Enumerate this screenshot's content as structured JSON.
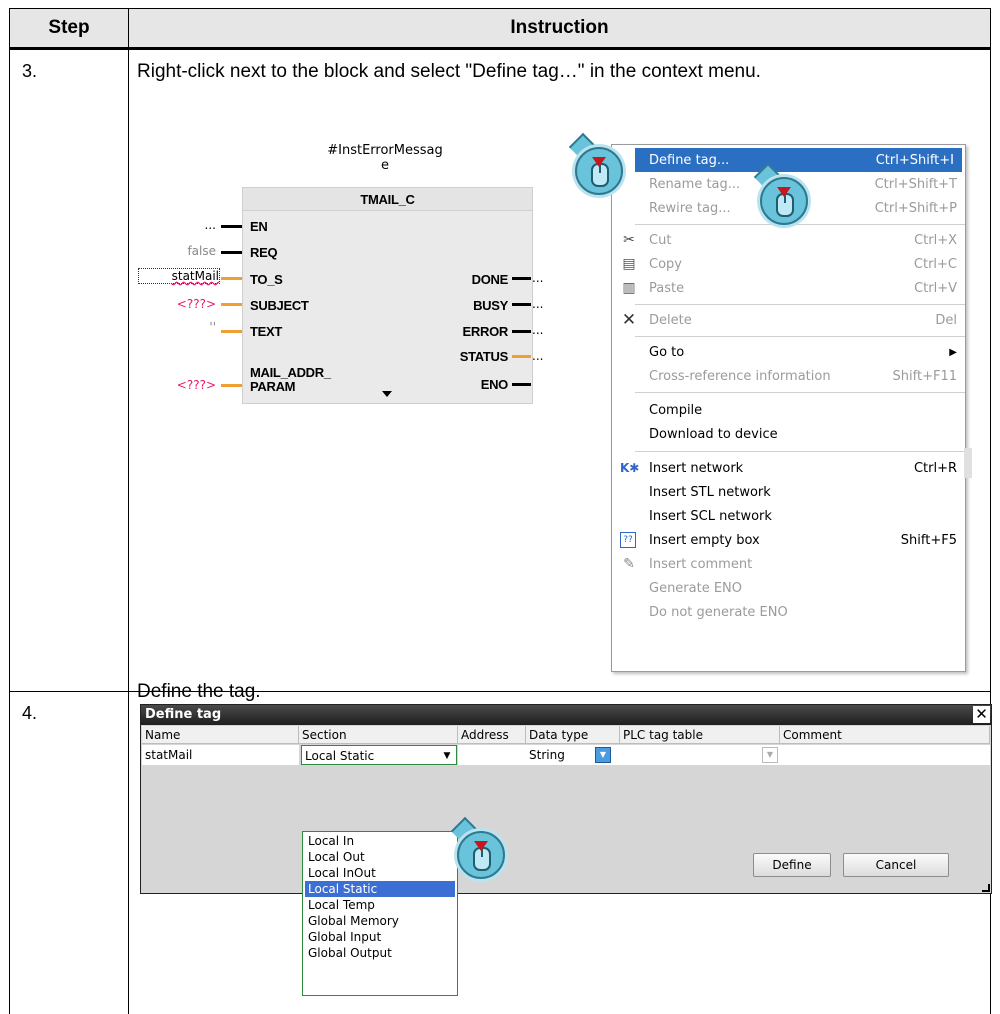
{
  "table": {
    "col_step": "Step",
    "col_instruction": "Instruction",
    "rows": [
      {
        "step": "3.",
        "instruction": "Right-click next to the block and select \"Define tag…\" in the context menu."
      },
      {
        "step": "4.",
        "instruction": "Define the tag."
      }
    ]
  },
  "fbd": {
    "instance_line1": "#InstErrorMessag",
    "instance_line2": "e",
    "block_name": "TMAIL_C",
    "inputs": [
      {
        "pin": "EN",
        "value": "..."
      },
      {
        "pin": "REQ",
        "value": "false"
      },
      {
        "pin": "TO_S",
        "value": "statMail"
      },
      {
        "pin": "SUBJECT",
        "value": "<???>"
      },
      {
        "pin": "TEXT",
        "value": "''"
      },
      {
        "pin": "MAIL_ADDR_",
        "value": ""
      },
      {
        "pin": "PARAM",
        "value": "<???>"
      }
    ],
    "outputs": [
      {
        "pin": "DONE",
        "value": "..."
      },
      {
        "pin": "BUSY",
        "value": "..."
      },
      {
        "pin": "ERROR",
        "value": "..."
      },
      {
        "pin": "STATUS",
        "value": "..."
      },
      {
        "pin": "ENO",
        "value": ""
      }
    ]
  },
  "context_menu": {
    "items": [
      {
        "label": "Define tag...",
        "shortcut": "Ctrl+Shift+I",
        "state": "selected",
        "icon": ""
      },
      {
        "label": "Rename tag...",
        "shortcut": "Ctrl+Shift+T",
        "state": "disabled",
        "icon": ""
      },
      {
        "label": "Rewire tag...",
        "shortcut": "Ctrl+Shift+P",
        "state": "disabled",
        "icon": ""
      },
      {
        "label": "Cut",
        "shortcut": "Ctrl+X",
        "state": "disabled",
        "icon": "scissors-icon"
      },
      {
        "label": "Copy",
        "shortcut": "Ctrl+C",
        "state": "disabled",
        "icon": "copy-icon"
      },
      {
        "label": "Paste",
        "shortcut": "Ctrl+V",
        "state": "disabled",
        "icon": "paste-icon"
      },
      {
        "label": "Delete",
        "shortcut": "Del",
        "state": "disabled",
        "icon": "delete-icon"
      },
      {
        "label": "Go to",
        "shortcut": "",
        "state": "submenu",
        "icon": ""
      },
      {
        "label": "Cross-reference information",
        "shortcut": "Shift+F11",
        "state": "disabled",
        "icon": ""
      },
      {
        "label": "Compile",
        "shortcut": "",
        "state": "normal",
        "icon": ""
      },
      {
        "label": "Download to device",
        "shortcut": "",
        "state": "normal",
        "icon": ""
      },
      {
        "label": "Insert network",
        "shortcut": "Ctrl+R",
        "state": "normal",
        "icon": "insert-network-icon"
      },
      {
        "label": "Insert STL network",
        "shortcut": "",
        "state": "normal",
        "icon": ""
      },
      {
        "label": "Insert SCL network",
        "shortcut": "",
        "state": "normal",
        "icon": ""
      },
      {
        "label": "Insert empty box",
        "shortcut": "Shift+F5",
        "state": "normal",
        "icon": "empty-box-icon"
      },
      {
        "label": "Insert comment",
        "shortcut": "",
        "state": "disabled",
        "icon": "comment-icon"
      },
      {
        "label": "Generate ENO",
        "shortcut": "",
        "state": "disabled",
        "icon": ""
      },
      {
        "label": "Do not generate ENO",
        "shortcut": "",
        "state": "disabled",
        "icon": ""
      }
    ]
  },
  "dialog": {
    "title": "Define tag",
    "headers": [
      "Name",
      "Section",
      "Address",
      "Data type",
      "PLC tag table",
      "Comment"
    ],
    "row": {
      "name": "statMail",
      "section": "Local Static",
      "address": "",
      "data_type": "String",
      "plc_tag_table": "",
      "comment": ""
    },
    "define_button": "Define",
    "cancel_button": "Cancel",
    "section_options": [
      "Local In",
      "Local Out",
      "Local InOut",
      "Local Static",
      "Local Temp",
      "Global Memory",
      "Global Input",
      "Global Output"
    ],
    "selected_option": "Local Static"
  },
  "colors": {
    "menu_highlight": "#2a6fc2",
    "dropdown_highlight": "#3c6fd3",
    "wire_orange": "#f0a030",
    "unset_value_red": "#e8176a"
  }
}
